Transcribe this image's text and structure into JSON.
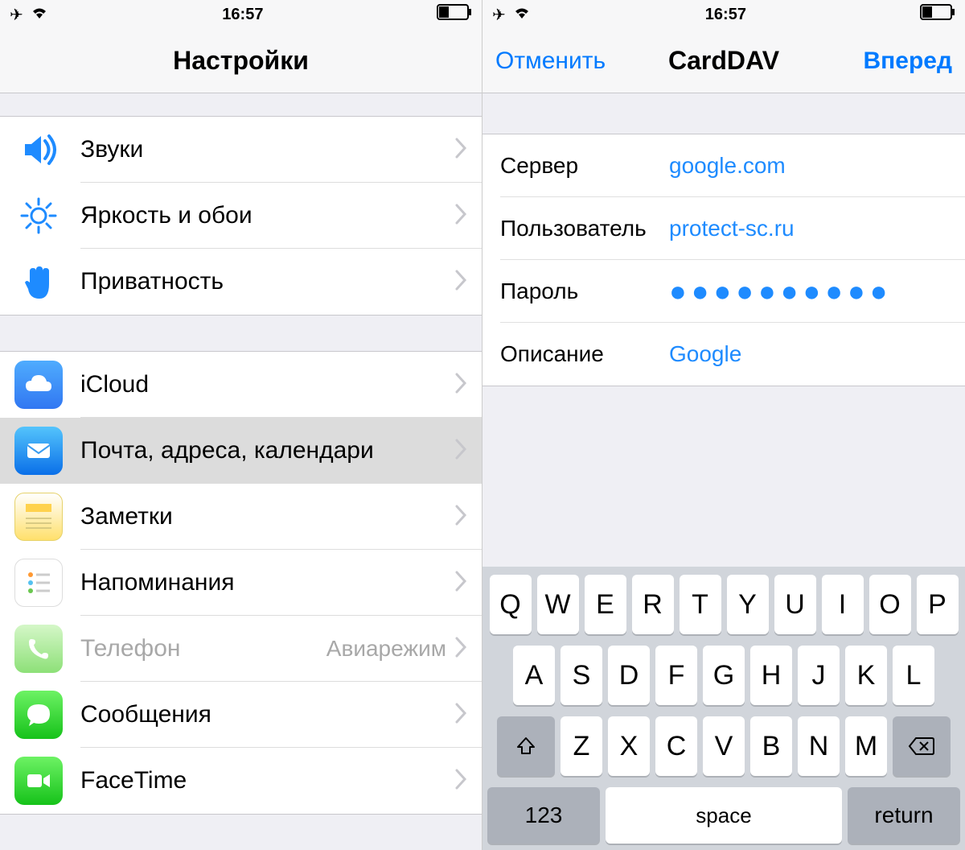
{
  "status_time": "16:57",
  "left": {
    "nav_title": "Настройки",
    "group1": [
      {
        "icon": "speaker",
        "label": "Звуки"
      },
      {
        "icon": "brightness",
        "label": "Яркость и обои"
      },
      {
        "icon": "hand",
        "label": "Приватность"
      }
    ],
    "group2": [
      {
        "icon": "icloud",
        "label": "iCloud"
      },
      {
        "icon": "mail",
        "label": "Почта, адреса, календари",
        "selected": true
      },
      {
        "icon": "notes",
        "label": "Заметки"
      },
      {
        "icon": "reminders",
        "label": "Напоминания"
      },
      {
        "icon": "phone",
        "label": "Телефон",
        "detail": "Авиарежим",
        "disabled": true
      },
      {
        "icon": "messages",
        "label": "Сообщения"
      },
      {
        "icon": "facetime",
        "label": "FaceTime"
      }
    ]
  },
  "right": {
    "nav_left": "Отменить",
    "nav_title": "CardDAV",
    "nav_right": "Вперед",
    "fields": {
      "server_label": "Сервер",
      "server_value": "google.com",
      "user_label": "Пользователь",
      "user_value": "protect-sc.ru",
      "password_label": "Пароль",
      "password_value": "●●●●●●●●●●",
      "desc_label": "Описание",
      "desc_value": "Google"
    }
  },
  "keyboard": {
    "row1": [
      "Q",
      "W",
      "E",
      "R",
      "T",
      "Y",
      "U",
      "I",
      "O",
      "P"
    ],
    "row2": [
      "A",
      "S",
      "D",
      "F",
      "G",
      "H",
      "J",
      "K",
      "L"
    ],
    "row3": [
      "Z",
      "X",
      "C",
      "V",
      "B",
      "N",
      "M"
    ],
    "num": "123",
    "space": "space",
    "return": "return"
  }
}
